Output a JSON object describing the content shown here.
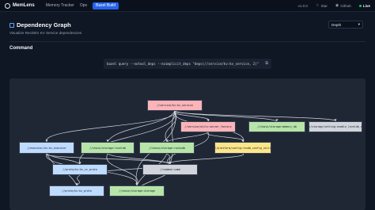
{
  "app": {
    "name": "MemLens",
    "nav": [
      {
        "label": "Memory Tracker"
      },
      {
        "label": "Ops"
      },
      {
        "label": "Bazel Build"
      }
    ],
    "topright": {
      "version": "v1.0.0",
      "star": "Star",
      "github": "Github",
      "live": "Live"
    }
  },
  "header": {
    "title": "Dependency Graph",
    "subtitle": "Visualize RecDB's KV Service dependencies",
    "depth_label": "Depth"
  },
  "command": {
    "section_label": "Command",
    "text": "bazel query --notool_deps --noimplicit_deps \"deps(//service/kv:kv_service, 2)\""
  },
  "graph": {
    "nodes": [
      {
        "label": "//service/kv:kv_service",
        "color": "#fbb4b9"
      },
      {
        "label": "//service/utils:server_factory",
        "color": "#fbb4b9"
      },
      {
        "label": "//chain/storage:memory_db",
        "color": "#b7e4a8"
      },
      {
        "label": "//chain/storage/setting:enable_leveldb_setting",
        "color": "#d1d5db"
      },
      {
        "label": "//executor/kv:kv_executor",
        "color": "#bfdbfe"
      },
      {
        "label": "//chain/storage:leveldb",
        "color": "#b7e4a8"
      },
      {
        "label": "//chain/storage:rocksdb",
        "color": "#b7e4a8"
      },
      {
        "label": "//platform/config:resdb_config_utils",
        "color": "#fde68a"
      },
      {
        "label": "//proto/kv:kv_cc_proto",
        "color": "#bfdbfe"
      },
      {
        "label": "//common:comm",
        "color": "#d1d5db"
      },
      {
        "label": "//proto/kv:kv_proto",
        "color": "#bfdbfe"
      },
      {
        "label": "//chain/storage:storage",
        "color": "#b7e4a8"
      }
    ]
  }
}
